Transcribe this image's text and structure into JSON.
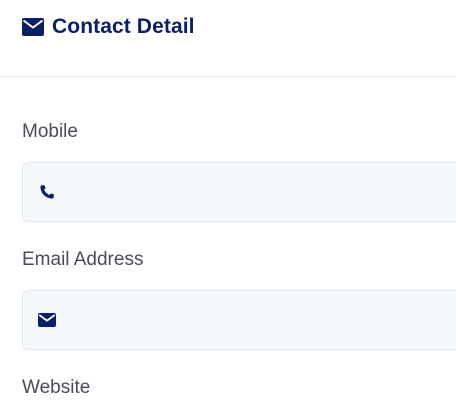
{
  "header": {
    "title": "Contact Detail",
    "icon": "envelope-icon",
    "color": "#0b1f66"
  },
  "fields": [
    {
      "label": "Mobile",
      "icon": "phone-icon",
      "value": "",
      "placeholder": ""
    },
    {
      "label": "Email Address",
      "icon": "envelope-icon",
      "value": "",
      "placeholder": ""
    },
    {
      "label": "Website"
    }
  ],
  "colors": {
    "accent": "#0b1f66",
    "field_bg": "#f5f9fd",
    "field_border": "#e3e8f1"
  }
}
